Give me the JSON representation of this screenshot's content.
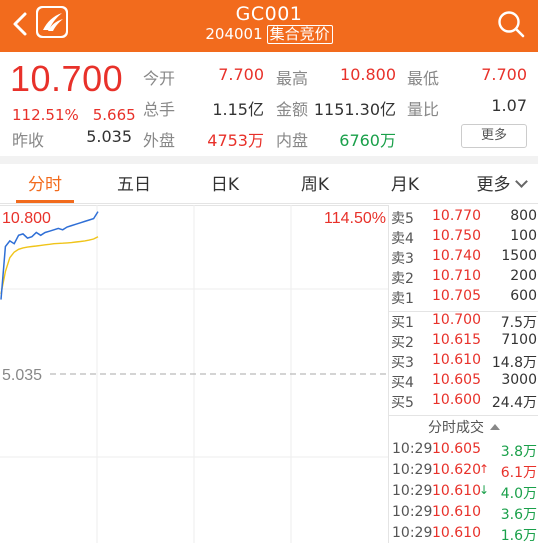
{
  "header": {
    "title": "GC001",
    "code": "204001",
    "tag": "集合竞价"
  },
  "quote": {
    "price": "10.700",
    "change_pct": "112.51%",
    "change_amt": "5.665",
    "prev_close_label": "昨收",
    "prev_close": "5.035",
    "stats": [
      {
        "label": "今开",
        "value": "7.700",
        "color": "red"
      },
      {
        "label": "最高",
        "value": "10.800",
        "color": "red"
      },
      {
        "label": "最低",
        "value": "7.700",
        "color": "red"
      },
      {
        "label": "总手",
        "value": "1.15亿",
        "color": "dark"
      },
      {
        "label": "金额",
        "value": "1151.30亿",
        "color": "dark"
      },
      {
        "label": "量比",
        "value": "1.07",
        "color": "dark"
      },
      {
        "label": "外盘",
        "value": "4753万",
        "color": "red"
      },
      {
        "label": "内盘",
        "value": "6760万",
        "color": "green"
      }
    ],
    "more_label": "更多"
  },
  "tabs": [
    "分时",
    "五日",
    "日K",
    "周K",
    "月K",
    "更多"
  ],
  "chart": {
    "max_label": "10.800",
    "max_pct": "114.50%",
    "base_label": "5.035"
  },
  "chart_data": {
    "type": "line",
    "series": [
      {
        "values": [
          7.7,
          9.6,
          9.8,
          9.7,
          10.0,
          10.05,
          9.9,
          9.95,
          10.1,
          10.0,
          10.1,
          10.15,
          10.2,
          10.25,
          10.2,
          10.3,
          10.35,
          10.4,
          10.45,
          10.5,
          10.55,
          10.6,
          10.85
        ]
      },
      {
        "values": [
          7.9,
          8.7,
          9.2,
          9.4,
          9.5,
          9.55,
          9.58,
          9.6,
          9.62,
          9.64,
          9.66,
          9.68,
          9.7,
          9.71,
          9.72,
          9.73,
          9.74,
          9.76,
          9.78,
          9.8,
          9.83,
          9.87,
          9.95
        ]
      }
    ],
    "ylim": [
      5.035,
      11.0
    ]
  },
  "order_book": {
    "asks": [
      {
        "label": "卖5",
        "price": "10.770",
        "volume": "800"
      },
      {
        "label": "卖4",
        "price": "10.750",
        "volume": "100"
      },
      {
        "label": "卖3",
        "price": "10.740",
        "volume": "1500"
      },
      {
        "label": "卖2",
        "price": "10.710",
        "volume": "200"
      },
      {
        "label": "卖1",
        "price": "10.705",
        "volume": "600"
      }
    ],
    "bids": [
      {
        "label": "买1",
        "price": "10.700",
        "volume": "7.5万"
      },
      {
        "label": "买2",
        "price": "10.615",
        "volume": "7100"
      },
      {
        "label": "买3",
        "price": "10.610",
        "volume": "14.8万"
      },
      {
        "label": "买4",
        "price": "10.605",
        "volume": "3000"
      },
      {
        "label": "买5",
        "price": "10.600",
        "volume": "24.4万"
      }
    ],
    "ticks_title": "分时成交",
    "ticks": [
      {
        "time": "10:29",
        "price": "10.605",
        "dir": "",
        "volume": "3.8万",
        "color": "#1aa04a"
      },
      {
        "time": "10:29",
        "price": "10.620",
        "dir": "↑",
        "volume": "6.1万",
        "color": "#e8312a"
      },
      {
        "time": "10:29",
        "price": "10.610",
        "dir": "↓",
        "volume": "4.0万",
        "color": "#1aa04a"
      },
      {
        "time": "10:29",
        "price": "10.610",
        "dir": "",
        "volume": "3.6万",
        "color": "#1aa04a"
      },
      {
        "time": "10:29",
        "price": "10.610",
        "dir": "",
        "volume": "1.6万",
        "color": "#1aa04a"
      }
    ]
  },
  "colors": {
    "brand": "#f26b1d",
    "up": "#e8312a",
    "down": "#1aa04a",
    "avg_line": "#f0c419",
    "price_line": "#2f6fd6"
  },
  "icons": [
    "back-arrow-icon",
    "app-logo-icon",
    "search-icon"
  ]
}
